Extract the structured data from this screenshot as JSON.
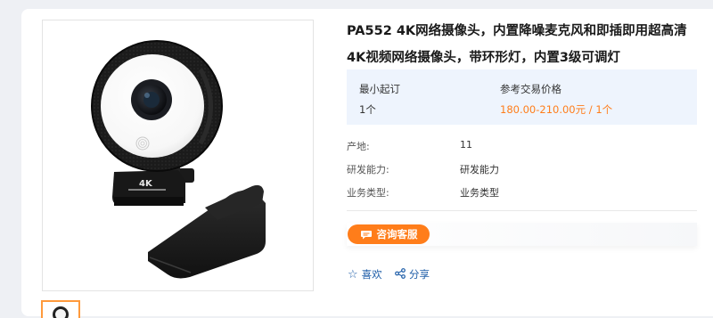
{
  "product": {
    "title": "PA552 4K网络摄像头，内置降噪麦克风和即插即用超高清4K视频网络摄像头，带环形灯，内置3级可调灯"
  },
  "pricing": {
    "moq_label": "最小起订",
    "moq_value": "1个",
    "price_label": "参考交易价格",
    "price_value": "180.00-210.00元 / 1个",
    "price_color": "#ff7d1a"
  },
  "attributes": [
    {
      "label": "产地:",
      "value": "11"
    },
    {
      "label": "研发能力:",
      "value": "研发能力"
    },
    {
      "label": "业务类型:",
      "value": "业务类型"
    }
  ],
  "actions": {
    "consult_label": "咨询客服",
    "consult_icon": "chat-bubble-icon",
    "favorite_label": "喜欢",
    "favorite_icon": "star-outline-icon",
    "share_label": "分享",
    "share_icon": "share-icon"
  },
  "product_image": {
    "camera_label": "4K"
  },
  "colors": {
    "accent": "#ff7d1a",
    "link": "#1f5ea8",
    "price_panel_bg": "#eef4fd"
  }
}
